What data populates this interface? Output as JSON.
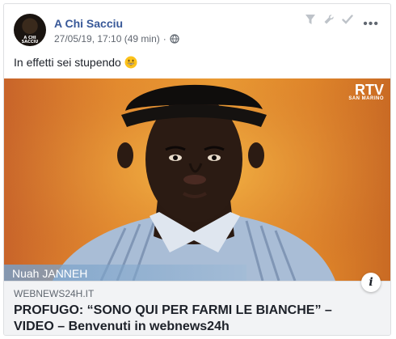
{
  "post": {
    "author": "A Chi Sacciu",
    "avatar_caption": "A CHI SACCIU",
    "timestamp": "27/05/19, 17:10 (49 min)",
    "separator": "·",
    "text": "In effetti sei stupendo",
    "emoji": "grinning-face-icon"
  },
  "media": {
    "channel_logo": "RTV",
    "channel_sub": "SAN MARINO",
    "lower_third": "Nuah JANNEH"
  },
  "link": {
    "domain": "WEBNEWS24H.IT",
    "title": "PROFUGO: “SONO QUI PER FARMI LE BIANCHE” – VIDEO – Benvenuti in webnews24h"
  },
  "icons": {
    "filter": "filter-icon",
    "wrench": "wrench-icon",
    "check": "check-icon",
    "more": "•••",
    "info": "i"
  }
}
